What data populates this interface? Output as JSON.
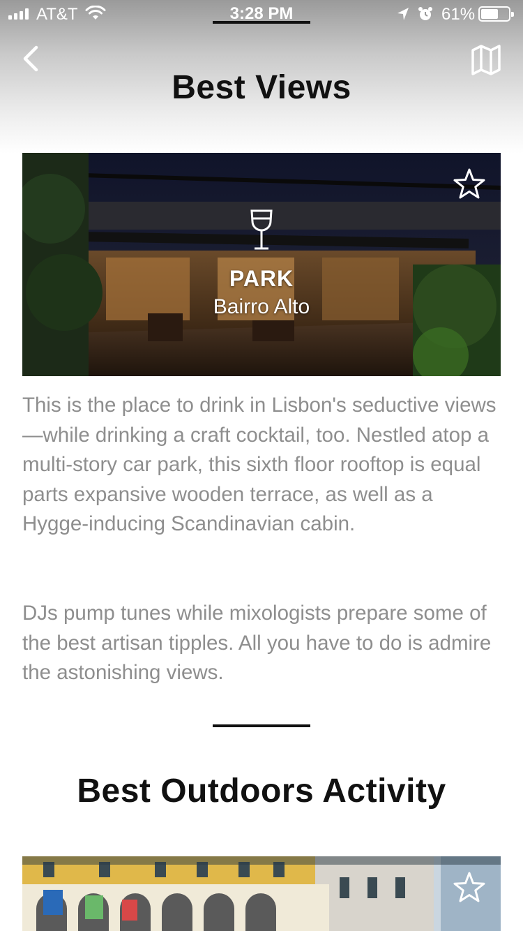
{
  "status_bar": {
    "carrier": "AT&T",
    "time": "3:28 PM",
    "battery_percent": "61%",
    "battery_level": 0.61
  },
  "header": {
    "title": "Best Views",
    "back_icon": "chevron-left-icon",
    "map_icon": "map-icon"
  },
  "sections": [
    {
      "card": {
        "name": "PARK",
        "area": "Bairro Alto",
        "category_icon": "wine-glass-icon",
        "favorite_icon": "star-outline-icon"
      },
      "description": [
        "This is the place to drink in Lisbon's seductive views—while drinking a craft cocktail, too. Nestled atop a multi-story car park, this sixth floor rooftop is equal parts expansive wooden terrace, as well as a Hygge-inducing Scandinavian cabin.",
        "DJs pump tunes while mixologists prepare some of the best artisan tipples. All you have to do is admire the astonishing views."
      ]
    },
    {
      "title": "Best Outdoors Activity",
      "card": {
        "favorite_icon": "star-outline-icon"
      }
    }
  ],
  "colors": {
    "title": "#111111",
    "body_text": "#8e8e8e",
    "overlay_text": "#ffffff"
  }
}
